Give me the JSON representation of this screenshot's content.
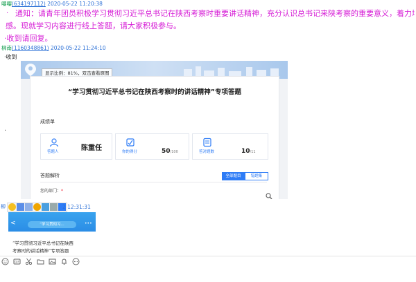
{
  "msg1": {
    "sender_name": "嘤嘤",
    "sender_qq": "634197112",
    "time": "2020-05-22 11:20:38",
    "lines": [
      "通知：请青年团员积极学习贯彻习近平总书记在陕西考察时重要讲话精神，充分认识总书记来陕考察的重要意义，着力增强责任",
      "感。现就学习内容进行线上答题，请大家积极参与。",
      "·收到请回复。"
    ]
  },
  "msg2": {
    "sender_name": "柳南",
    "sender_qq": "1160348861",
    "time": "2020-05-22 11:24:10",
    "text": "·收到"
  },
  "image_viewer": {
    "zoom_hint": "显示比例：81%，双击查看原图"
  },
  "quiz": {
    "title": "“学习贯彻习近平总书记在陕西考察时的讲话精神”专项答题",
    "scorecard_label": "成绩单",
    "answerer_label": "答题人",
    "answerer_name": "陈重任",
    "score_label": "你的得分",
    "score_value": "50",
    "score_total": "/100",
    "correct_label": "答对题数",
    "correct_value": "10",
    "correct_total": "/11",
    "analysis_label": "答题解析",
    "tab_all": "全部题目",
    "tab_wrong": "错题集",
    "dept_label": "您的部门：",
    "required_mark": "*"
  },
  "msg3": {
    "time_fragment": "2 12:31:31"
  },
  "phone": {
    "nav_title": "“学习贯彻习...",
    "back": "<",
    "more": "•••",
    "title_line1": "“学习贯彻习近平总书记在陕西",
    "title_line2": "考察时的讲话精神”专项答题"
  },
  "colors": {
    "notice": "#d61ed6",
    "accent_blue": "#2e7cf6",
    "sender_green": "#0a9a47"
  }
}
